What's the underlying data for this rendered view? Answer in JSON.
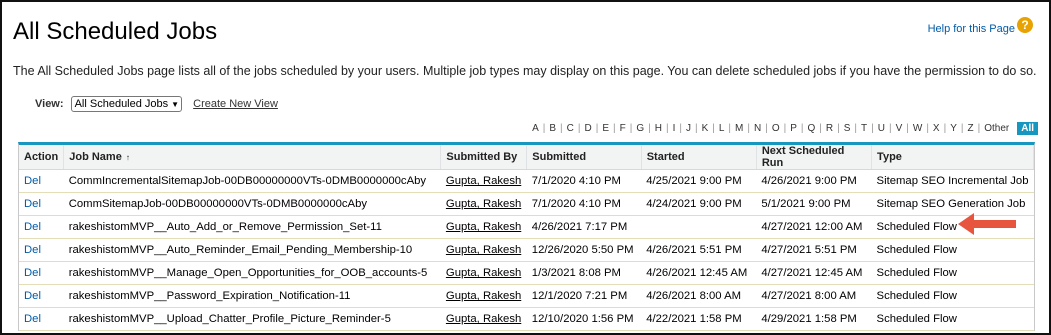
{
  "page": {
    "title": "All Scheduled Jobs",
    "help_link": "Help for this Page",
    "help_icon": "?",
    "description": "The All Scheduled Jobs page lists all of the jobs scheduled by your users. Multiple job types may display on this page. You can delete scheduled jobs if you have the permission to do so."
  },
  "view": {
    "label": "View:",
    "selected": "All Scheduled Jobs",
    "create_link": "Create New View"
  },
  "alphabet": [
    "A",
    "B",
    "C",
    "D",
    "E",
    "F",
    "G",
    "H",
    "I",
    "J",
    "K",
    "L",
    "M",
    "N",
    "O",
    "P",
    "Q",
    "R",
    "S",
    "T",
    "U",
    "V",
    "W",
    "X",
    "Y",
    "Z",
    "Other"
  ],
  "alphabet_selected": "All",
  "table": {
    "headers": {
      "action": "Action",
      "job_name": "Job Name",
      "sort_indicator": "↑",
      "submitted_by": "Submitted By",
      "submitted": "Submitted",
      "started": "Started",
      "next_run": "Next Scheduled Run",
      "type": "Type"
    },
    "rows": [
      {
        "action": "Del",
        "job_name": "CommIncrementalSitemapJob-00DB00000000VTs-0DMB0000000cAby",
        "submitted_by": "Gupta, Rakesh",
        "submitted": "7/1/2020 4:10 PM",
        "started": "4/25/2021 9:00 PM",
        "next_run": "4/26/2021 9:00 PM",
        "type": "Sitemap SEO Incremental Job"
      },
      {
        "action": "Del",
        "job_name": "CommSitemapJob-00DB00000000VTs-0DMB0000000cAby",
        "submitted_by": "Gupta, Rakesh",
        "submitted": "7/1/2020 4:10 PM",
        "started": "4/24/2021 9:00 PM",
        "next_run": "5/1/2021 9:00 PM",
        "type": "Sitemap SEO Generation Job"
      },
      {
        "action": "Del",
        "job_name": "rakeshistomMVP__Auto_Add_or_Remove_Permission_Set-11",
        "submitted_by": "Gupta, Rakesh",
        "submitted": "4/26/2021 7:17 PM",
        "started": "",
        "next_run": "4/27/2021 12:00 AM",
        "type": "Scheduled Flow"
      },
      {
        "action": "Del",
        "job_name": "rakeshistomMVP__Auto_Reminder_Email_Pending_Membership-10",
        "submitted_by": "Gupta, Rakesh",
        "submitted": "12/26/2020 5:50 PM",
        "started": "4/26/2021 5:51 PM",
        "next_run": "4/27/2021 5:51 PM",
        "type": "Scheduled Flow"
      },
      {
        "action": "Del",
        "job_name": "rakeshistomMVP__Manage_Open_Opportunities_for_OOB_accounts-5",
        "submitted_by": "Gupta, Rakesh",
        "submitted": "1/3/2021 8:08 PM",
        "started": "4/26/2021 12:45 AM",
        "next_run": "4/27/2021 12:45 AM",
        "type": "Scheduled Flow"
      },
      {
        "action": "Del",
        "job_name": "rakeshistomMVP__Password_Expiration_Notification-11",
        "submitted_by": "Gupta, Rakesh",
        "submitted": "12/1/2020 7:21 PM",
        "started": "4/26/2021 8:00 AM",
        "next_run": "4/27/2021 8:00 AM",
        "type": "Scheduled Flow"
      },
      {
        "action": "Del",
        "job_name": "rakeshistomMVP__Upload_Chatter_Profile_Picture_Reminder-5",
        "submitted_by": "Gupta, Rakesh",
        "submitted": "12/10/2020 1:56 PM",
        "started": "4/22/2021 1:58 PM",
        "next_run": "4/29/2021 1:58 PM",
        "type": "Scheduled Flow"
      }
    ]
  },
  "annotation": {
    "arrow_color": "#e8553f"
  },
  "colors": {
    "accent": "#1797c0",
    "link": "#015ba7",
    "help_icon": "#e8a202"
  }
}
